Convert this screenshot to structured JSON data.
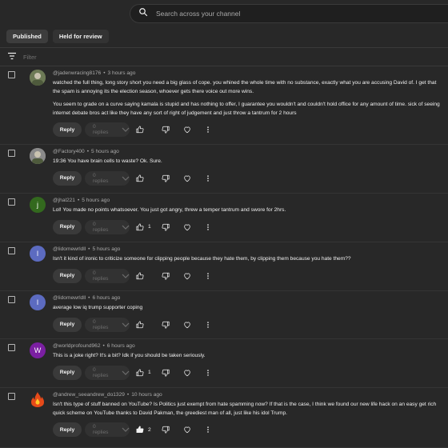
{
  "search": {
    "placeholder": "Search across your channel"
  },
  "tabs": [
    {
      "label": "Published"
    },
    {
      "label": "Held for review"
    }
  ],
  "filter": {
    "label": "Filter"
  },
  "actions": {
    "reply_label": "Reply",
    "replies_label": "0 replies"
  },
  "comments": [
    {
      "author": "@jadenwracing8176",
      "time": "3 hours ago",
      "paragraphs": [
        "watched the full thing, long story short you need a big glass of cope. you whined the whole time with no substance, exactly what you are accusing David of. I get that the spam is annoying its the election season, whoever gets there voice out more wins.",
        "You seem to grade on a curve saying kamala is stupid and has nothing to offer, I guarantee you wouldn't and couldn't hold office for any amount of time. sick of seeing internet debate bros act like they have any sort of right of judgement and just throw a tantrum for 2 hours"
      ],
      "likes": "",
      "avatar": {
        "type": "image",
        "color": "#6d7a56",
        "letter": ""
      }
    },
    {
      "author": "@Factory400",
      "time": "5 hours ago",
      "paragraphs": [
        "19:36 You have brain cells to waste? Ok. Sure."
      ],
      "likes": "",
      "avatar": {
        "type": "image",
        "color": "#8a8a8a",
        "letter": ""
      }
    },
    {
      "author": "@jhal221",
      "time": "5 hours ago",
      "paragraphs": [
        "Lol! You made no points whatsoever. You just got angry, threw a temper tantrum and swore for 2hrs."
      ],
      "likes": "1",
      "avatar": {
        "type": "letter",
        "color": "#33691e",
        "letter": "j"
      }
    },
    {
      "author": "@lidomewrldll",
      "time": "5 hours ago",
      "paragraphs": [
        "Isn't it kind of ironic to criticize someone for clipping people because they hate them, by clipping them because you hate them??"
      ],
      "likes": "",
      "avatar": {
        "type": "letter",
        "color": "#5c6bc0",
        "letter": "l"
      }
    },
    {
      "author": "@lidomewrldll",
      "time": "6 hours ago",
      "paragraphs": [
        "average low iq trump supporter coping"
      ],
      "likes": "",
      "avatar": {
        "type": "letter",
        "color": "#5c6bc0",
        "letter": "l"
      }
    },
    {
      "author": "@worldprofound962",
      "time": "6 hours ago",
      "paragraphs": [
        "This is a joke right? It's a bit? Idk if you should be taken seriously."
      ],
      "likes": "1",
      "avatar": {
        "type": "letter",
        "color": "#7b1fa2",
        "letter": "W"
      }
    },
    {
      "author": "@andrew_seeandrew_do1329",
      "time": "10 hours ago",
      "paragraphs": [
        "Isn't this type of stuff banned on YouTube? Is Politics just exempt from hate spamming now? If that is the case, I think we found our new life hack on an easy get rich quick scheme on YouTube thanks to David Pakman, the greediest man of all, just like his idol Trump."
      ],
      "likes": "2",
      "avatar": {
        "type": "fire",
        "color": "#c62828",
        "letter": ""
      }
    }
  ],
  "colors": {
    "background": "#282828",
    "text": "#f1f1f1",
    "muted": "#aaaaaa"
  }
}
